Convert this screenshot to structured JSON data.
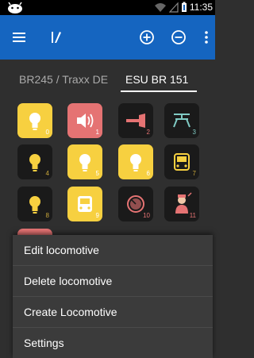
{
  "status_bar": {
    "time": "11:35",
    "icons": [
      "android-icon",
      "wifi-icon",
      "signal-icon",
      "battery-icon"
    ]
  },
  "app_bar": {
    "icons": [
      "menu-icon",
      "app-logo-icon",
      "add-circle-icon",
      "remove-circle-icon",
      "overflow-icon"
    ],
    "color": "#1565c0"
  },
  "tabs": [
    {
      "label": "BR245 / Traxx DE",
      "active": false
    },
    {
      "label": "ESU BR 151",
      "active": true
    }
  ],
  "functions": [
    {
      "num": "0",
      "icon": "lightbulb-icon",
      "state": "yellow"
    },
    {
      "num": "1",
      "icon": "speaker-icon",
      "state": "red"
    },
    {
      "num": "2",
      "icon": "horn-icon",
      "state": "off"
    },
    {
      "num": "3",
      "icon": "water-crane-icon",
      "state": "off"
    },
    {
      "num": "4",
      "icon": "lightbulb-icon",
      "state": "off"
    },
    {
      "num": "5",
      "icon": "lightbulb-icon",
      "state": "yellow"
    },
    {
      "num": "6",
      "icon": "lightbulb-icon",
      "state": "yellow"
    },
    {
      "num": "7",
      "icon": "cab-light-icon",
      "state": "off"
    },
    {
      "num": "8",
      "icon": "lightbulb-icon",
      "state": "off"
    },
    {
      "num": "9",
      "icon": "train-front-icon",
      "state": "yellow"
    },
    {
      "num": "10",
      "icon": "gauge-icon",
      "state": "off"
    },
    {
      "num": "11",
      "icon": "conductor-icon",
      "state": "off"
    }
  ],
  "menu": {
    "items": [
      {
        "label": "Edit locomotive"
      },
      {
        "label": "Delete locomotive"
      },
      {
        "label": "Create Locomotive"
      },
      {
        "label": "Settings"
      }
    ]
  },
  "colors": {
    "accent_yellow": "#f7d040",
    "accent_red": "#e57373",
    "dark_tile": "#1a1a1a"
  }
}
